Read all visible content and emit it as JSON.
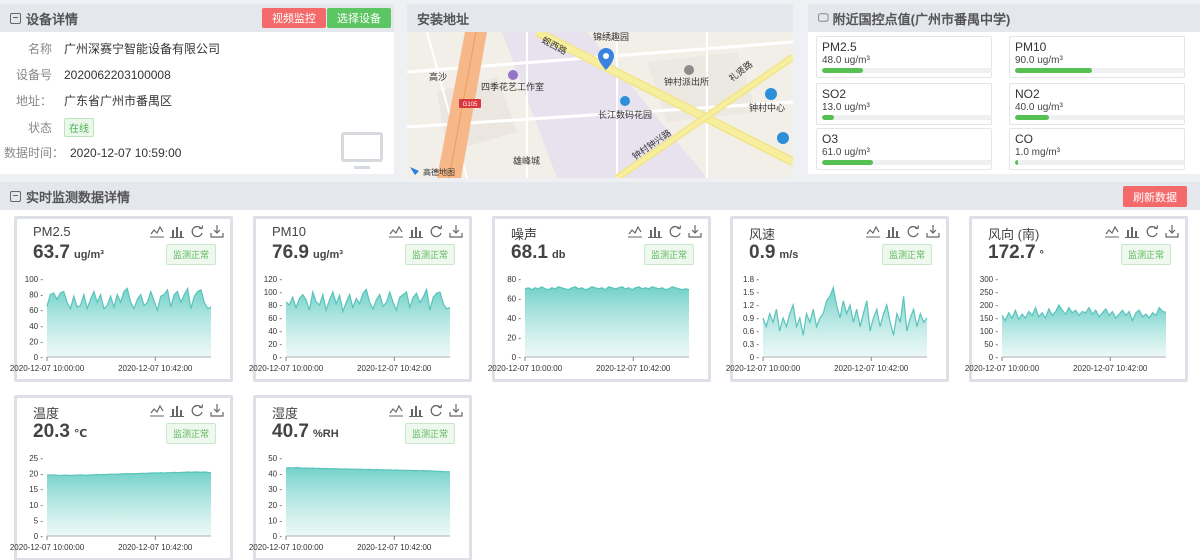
{
  "device": {
    "title": "设备详情",
    "video_button": "视频监控",
    "select_button": "选择设备",
    "rows": [
      {
        "label": "名称",
        "value": "广州深赛宁智能设备有限公司"
      },
      {
        "label": "设备号",
        "value": "2020062203100008"
      },
      {
        "label": "地址：",
        "value": "广东省广州市番禺区"
      },
      {
        "label": "状态",
        "value": "在线"
      },
      {
        "label": "数据时间：",
        "value": "2020-12-07 10:59:00"
      }
    ]
  },
  "map": {
    "title": "安装地址",
    "labels": [
      "锦绣趣园",
      "钟村派出所",
      "礼贤路",
      "钟村中心",
      "四季花艺工作室",
      "高沙",
      "长江数码花园",
      "钟村钟兴路",
      "雄峰城",
      "蚬西路",
      "高德地图",
      "G105"
    ]
  },
  "air": {
    "title": "附近国控点值(广州市番禺中学)",
    "items": [
      {
        "name": "PM2.5",
        "value": "48.0 ug/m³",
        "level": 0.24
      },
      {
        "name": "PM10",
        "value": "90.0 ug/m³",
        "level": 0.45
      },
      {
        "name": "SO2",
        "value": "13.0 ug/m³",
        "level": 0.07
      },
      {
        "name": "NO2",
        "value": "40.0 ug/m³",
        "level": 0.2
      },
      {
        "name": "O3",
        "value": "61.0 ug/m³",
        "level": 0.3
      },
      {
        "name": "CO",
        "value": "1.0 mg/m³",
        "level": 0.02
      }
    ]
  },
  "realtime": {
    "title": "实时监测数据详情",
    "refresh_button": "刷新数据"
  },
  "cards": [
    {
      "name": "PM2.5",
      "value": "63.7",
      "unit": "ug/m³",
      "status": "监测正常"
    },
    {
      "name": "PM10",
      "value": "76.9",
      "unit": "ug/m³",
      "status": "监测正常"
    },
    {
      "name": "噪声",
      "value": "68.1",
      "unit": "db",
      "status": "监测正常"
    },
    {
      "name": "风速",
      "value": "0.9",
      "unit": "m/s",
      "status": "监测正常"
    },
    {
      "name": "风向 (南)",
      "value": "172.7",
      "unit": "°",
      "status": "监测正常"
    },
    {
      "name": "温度",
      "value": "20.3",
      "unit": "℃",
      "status": "监测正常"
    },
    {
      "name": "湿度",
      "value": "40.7",
      "unit": "%RH",
      "status": "监测正常"
    }
  ],
  "chart_data": [
    {
      "type": "area",
      "x_ticks": [
        "2020-12-07 10:00:00",
        "2020-12-07 10:42:00"
      ],
      "y_ticks": [
        "0",
        "20",
        "40",
        "60",
        "80",
        "100"
      ],
      "ylim": [
        0,
        100
      ],
      "values": [
        65,
        80,
        82,
        74,
        82,
        84,
        70,
        62,
        78,
        64,
        66,
        80,
        62,
        74,
        84,
        70,
        80,
        62,
        66,
        78,
        64,
        80,
        70,
        84,
        88,
        70,
        62,
        74,
        80,
        66,
        70,
        84,
        72,
        60,
        78,
        80,
        86,
        64,
        80,
        84,
        70,
        80,
        88,
        62,
        78,
        84,
        86,
        70,
        62,
        64
      ]
    },
    {
      "type": "area",
      "x_ticks": [
        "2020-12-07 10:00:00",
        "2020-12-07 10:42:00"
      ],
      "y_ticks": [
        "0",
        "20",
        "40",
        "60",
        "80",
        "100",
        "120"
      ],
      "ylim": [
        0,
        120
      ],
      "values": [
        85,
        80,
        92,
        76,
        90,
        96,
        88,
        72,
        100,
        85,
        80,
        96,
        72,
        88,
        100,
        82,
        95,
        70,
        84,
        96,
        76,
        90,
        82,
        98,
        104,
        84,
        74,
        88,
        96,
        78,
        84,
        100,
        84,
        72,
        92,
        96,
        100,
        76,
        92,
        98,
        84,
        92,
        104,
        72,
        92,
        98,
        100,
        82,
        74,
        76
      ]
    },
    {
      "type": "area",
      "x_ticks": [
        "2020-12-07 10:00:00",
        "2020-12-07 10:42:00"
      ],
      "y_ticks": [
        "0",
        "20",
        "40",
        "60",
        "80"
      ],
      "ylim": [
        0,
        80
      ],
      "values": [
        70,
        71,
        69,
        71,
        70,
        72,
        70,
        69,
        71,
        70,
        72,
        71,
        70,
        69,
        71,
        72,
        70,
        71,
        69,
        70,
        72,
        71,
        70,
        71,
        69,
        72,
        71,
        70,
        71,
        72,
        70,
        71,
        69,
        71,
        72,
        70,
        71,
        70,
        72,
        71,
        70,
        71,
        69,
        70,
        72,
        71,
        70,
        69,
        70,
        69
      ]
    },
    {
      "type": "area",
      "x_ticks": [
        "2020-12-07 10:00:00",
        "2020-12-07 10:42:00"
      ],
      "y_ticks": [
        "0",
        "0.3",
        "0.6",
        "0.9",
        "1.2",
        "1.5",
        "1.8"
      ],
      "ylim": [
        0,
        1.8
      ],
      "values": [
        0.9,
        0.7,
        1.0,
        0.8,
        1.1,
        0.6,
        0.9,
        0.7,
        1.0,
        1.2,
        0.7,
        0.9,
        0.5,
        1.0,
        0.8,
        1.1,
        0.7,
        0.9,
        1.0,
        1.3,
        1.4,
        1.6,
        1.2,
        0.9,
        1.3,
        1.0,
        1.2,
        0.8,
        1.1,
        0.7,
        1.0,
        1.3,
        0.6,
        0.9,
        1.1,
        0.7,
        1.0,
        1.2,
        0.8,
        0.5,
        1.0,
        0.8,
        1.4,
        0.6,
        0.9,
        1.1,
        0.7,
        1.0,
        0.8,
        0.9
      ]
    },
    {
      "type": "area",
      "x_ticks": [
        "2020-12-07 10:00:00",
        "2020-12-07 10:42:00"
      ],
      "y_ticks": [
        "0",
        "50",
        "100",
        "150",
        "200",
        "250",
        "300"
      ],
      "ylim": [
        0,
        300
      ],
      "values": [
        160,
        140,
        170,
        150,
        180,
        145,
        165,
        150,
        175,
        160,
        190,
        155,
        170,
        150,
        185,
        160,
        175,
        200,
        180,
        165,
        190,
        170,
        180,
        160,
        175,
        170,
        190,
        165,
        180,
        155,
        170,
        185,
        160,
        175,
        150,
        165,
        180,
        160,
        175,
        140,
        170,
        180,
        155,
        165,
        150,
        170,
        160,
        190,
        175,
        172
      ]
    },
    {
      "type": "area",
      "x_ticks": [
        "2020-12-07 10:00:00",
        "2020-12-07 10:42:00"
      ],
      "y_ticks": [
        "0",
        "5",
        "10",
        "15",
        "20",
        "25"
      ],
      "ylim": [
        0,
        25
      ],
      "values": [
        19.6,
        19.5,
        19.6,
        19.5,
        19.4,
        19.5,
        19.5,
        19.4,
        19.5,
        19.5,
        19.6,
        19.5,
        19.5,
        19.6,
        19.6,
        19.7,
        19.6,
        19.7,
        19.7,
        19.8,
        19.8,
        19.8,
        19.9,
        19.9,
        20.0,
        19.9,
        20.0,
        20.0,
        20.1,
        20.1,
        20.1,
        20.2,
        20.2,
        20.2,
        20.3,
        20.2,
        20.3,
        20.3,
        20.4,
        20.3,
        20.4,
        20.4,
        20.5,
        20.4,
        20.5,
        20.5,
        20.4,
        20.5,
        20.4,
        20.3
      ]
    },
    {
      "type": "area",
      "x_ticks": [
        "2020-12-07 10:00:00",
        "2020-12-07 10:42:00"
      ],
      "y_ticks": [
        "0",
        "10",
        "20",
        "30",
        "40",
        "50"
      ],
      "ylim": [
        0,
        50
      ],
      "values": [
        43.5,
        43.8,
        43.6,
        43.9,
        43.7,
        43.5,
        43.6,
        43.4,
        43.5,
        43.3,
        43.4,
        43.2,
        43.3,
        43.1,
        43.2,
        43.0,
        43.1,
        42.9,
        43.0,
        42.8,
        42.9,
        42.7,
        42.8,
        42.7,
        42.6,
        42.7,
        42.5,
        42.6,
        42.4,
        42.5,
        42.3,
        42.4,
        42.2,
        42.3,
        42.1,
        42.2,
        42.0,
        42.1,
        41.9,
        42.0,
        41.8,
        41.9,
        41.7,
        41.8,
        41.6,
        41.5,
        41.4,
        41.3,
        41.2,
        41.1
      ]
    }
  ]
}
